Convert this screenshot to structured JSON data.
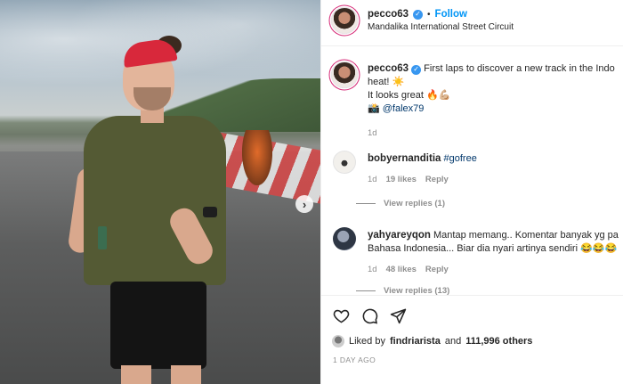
{
  "post": {
    "username": "pecco63",
    "follow_label": "Follow",
    "dot": "•",
    "location": "Mandalika International Street Circuit",
    "verified_glyph": "✓",
    "next_glyph": "›"
  },
  "caption": {
    "username": "pecco63",
    "line1": "First laps to discover a new track in the Indo",
    "line2": "heat! ☀️",
    "line3": "It looks great 🔥💪🏼",
    "camera_emoji": "📸",
    "mention": "@falex79",
    "age": "1d"
  },
  "comments": [
    {
      "username": "bobyernanditia",
      "text": "#gofree",
      "age": "1d",
      "likes": "19 likes",
      "reply": "Reply",
      "view_replies": "View replies (1)"
    },
    {
      "username": "yahyareyqon",
      "line1": "Mantap memang.. Komentar banyak yg pa",
      "line2": "Bahasa Indonesia... Biar dia nyari artinya sendiri 😂😂😂",
      "age": "1d",
      "likes": "48 likes",
      "reply": "Reply",
      "view_replies": "View replies (13)"
    }
  ],
  "footer": {
    "liked_by": "Liked by",
    "liker": "findriarista",
    "and": "and",
    "others": "111,996 others",
    "timestamp": "1 DAY AGO"
  },
  "icons": [
    "heart-icon",
    "comment-icon",
    "share-icon",
    "verified-badge-icon",
    "chevron-right-icon"
  ],
  "colors": {
    "link": "#0095f6",
    "mention": "#00376b",
    "muted": "#8e8e8e",
    "verified": "#3897f0"
  }
}
